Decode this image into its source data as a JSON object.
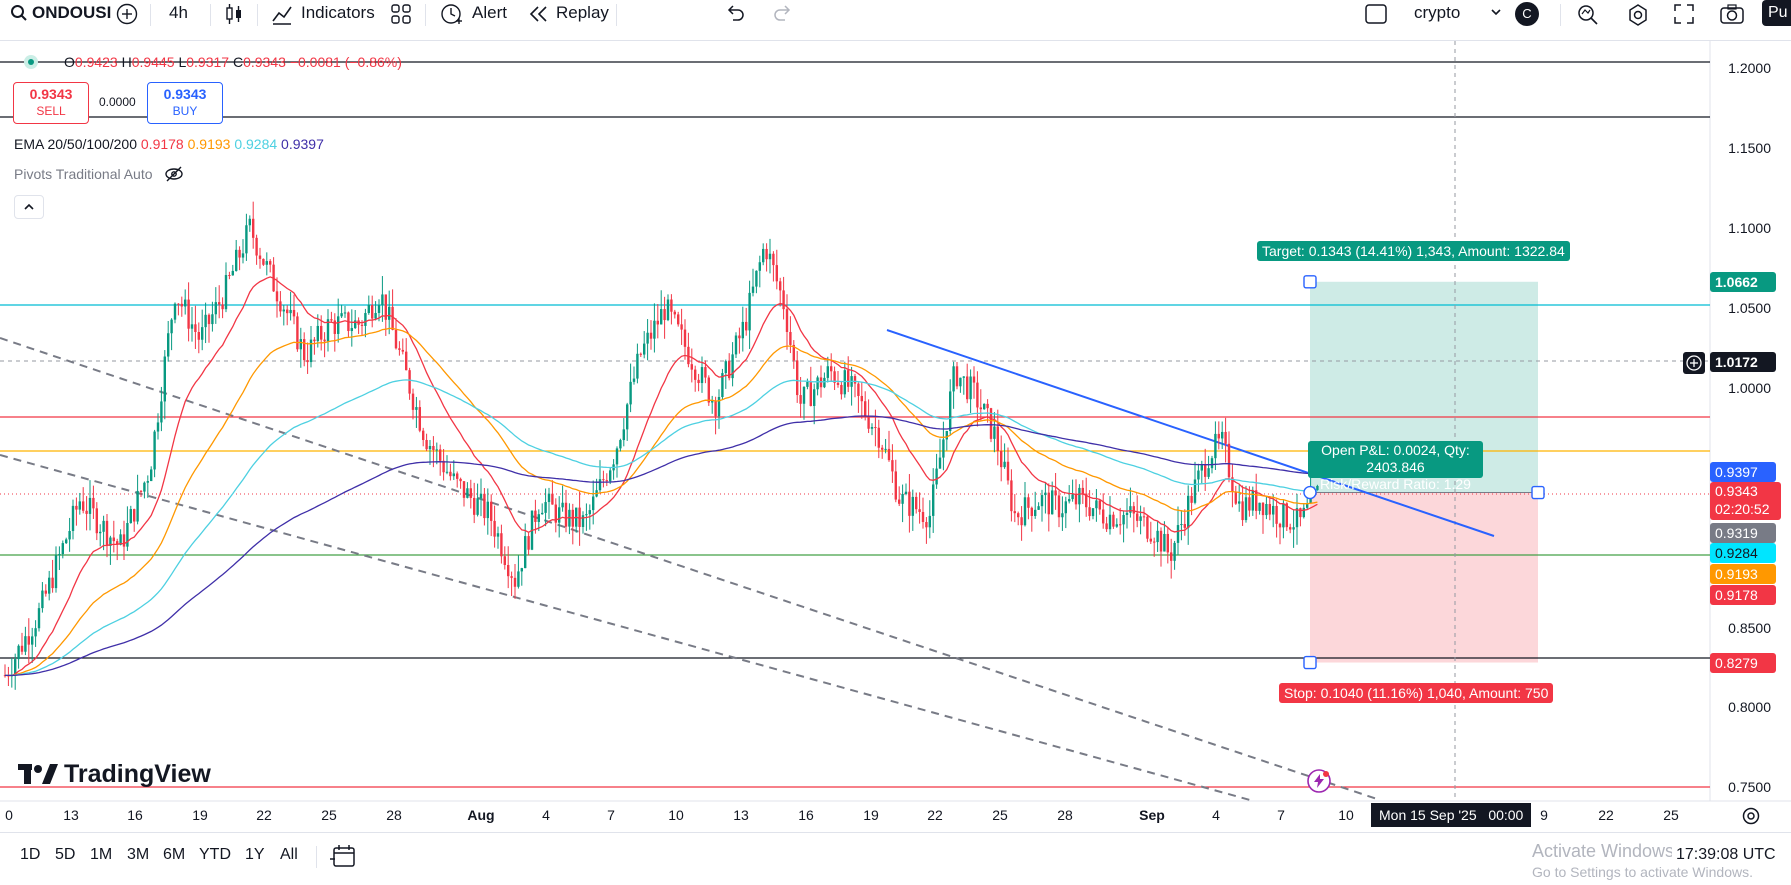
{
  "toolbar": {
    "symbol": "ONDOUSI",
    "interval": "4h",
    "indicators_label": "Indicators",
    "alert_label": "Alert",
    "replay_label": "Replay",
    "layout_name": "crypto",
    "layout_avatar": "C",
    "publish_label": "Pu"
  },
  "legend": {
    "ohlc": {
      "o_label": "O",
      "o": "0.9423",
      "h_label": "H",
      "h": "0.9445",
      "l_label": "L",
      "l": "0.9317",
      "c_label": "C",
      "c": "0.9343",
      "change": "−0.0081 (−0.86%)"
    },
    "sell_price": "0.9343",
    "sell_label": "SELL",
    "spread": "0.0000",
    "buy_price": "0.9343",
    "buy_label": "BUY",
    "ema_label": "EMA 20/50/100/200",
    "ema_values": [
      "0.9178",
      "0.9193",
      "0.9284",
      "0.9397"
    ],
    "pivots_label": "Pivots Traditional Auto"
  },
  "position": {
    "target_text": "Target: 0.1343 (14.41%) 1,343, Amount: 1322.84",
    "pnl_text": "Open P&L: 0.0024, Qty: 2403.846",
    "rr_text": "Risk/Reward Ratio: 1.29",
    "stop_text": "Stop: 0.1040 (11.16%) 1,040, Amount: 750"
  },
  "price_axis": {
    "ticks": [
      "1.2000",
      "1.1500",
      "1.1000",
      "1.0500",
      "1.0000",
      "0.8500",
      "0.8000",
      "0.7500"
    ],
    "tags": {
      "target": "1.0662",
      "crosshair": "1.0172",
      "ema200": "0.9397",
      "last": "0.9343",
      "countdown": "02:20:52",
      "low": "0.9319",
      "ema100": "0.9284",
      "ema50": "0.9193",
      "ema20": "0.9178",
      "stop": "0.8279"
    }
  },
  "time_axis": {
    "ticks": [
      "0",
      "13",
      "16",
      "19",
      "22",
      "25",
      "28",
      "Aug",
      "4",
      "7",
      "10",
      "13",
      "16",
      "19",
      "22",
      "25",
      "28",
      "Sep",
      "4",
      "7",
      "10",
      "9",
      "22",
      "25"
    ],
    "crosshair_date": "Mon 15 Sep '25",
    "crosshair_time": "00:00"
  },
  "bottombar": {
    "ranges": [
      "1D",
      "5D",
      "1M",
      "3M",
      "6M",
      "YTD",
      "1Y",
      "All"
    ],
    "clock": "17:39:08 UTC"
  },
  "watermark": {
    "brand": "TradingView",
    "activate_title": "Activate Windows",
    "activate_sub": "Go to Settings to activate Windows."
  },
  "colors": {
    "up": "#089981",
    "down": "#f23645",
    "ema20": "#f23645",
    "ema50": "#ff9800",
    "ema100": "#4dd0e1",
    "ema200": "#3f2fa8",
    "trend": "#2962ff",
    "target_bg": "#089981",
    "stop_bg": "#f23645"
  }
}
